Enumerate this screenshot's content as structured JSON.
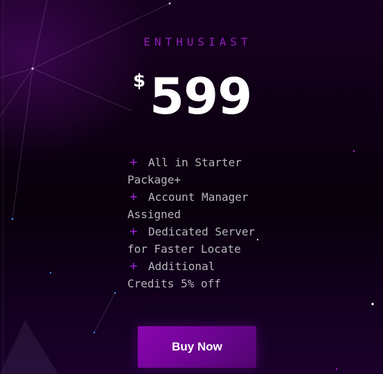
{
  "plan": {
    "tier": "ENTHUSIAST",
    "currency": "$",
    "price": "599",
    "features": [
      "All in Starter Package+",
      "Account Manager Assigned",
      "Dedicated Server for Faster Locate",
      "Additional Credits 5% off"
    ],
    "bullet": "+",
    "cta_label": "Buy Now"
  },
  "colors": {
    "background": "#050007",
    "accent": "#8e1fb8",
    "button": "#8a05b0",
    "feature_text": "#b8b6bd"
  }
}
